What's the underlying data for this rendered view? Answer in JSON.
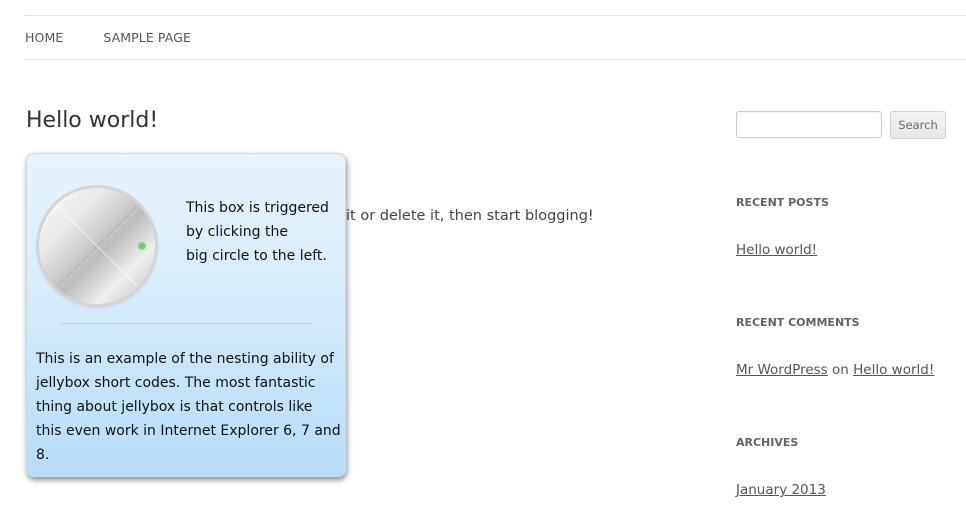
{
  "nav": {
    "items": [
      {
        "label": "HOME"
      },
      {
        "label": "SAMPLE PAGE"
      }
    ]
  },
  "post": {
    "title": "Hello world!",
    "content_visible": "it or delete it, then start blogging!"
  },
  "jellybox": {
    "trigger_lines": [
      "This box is triggered",
      "by clicking the",
      "big circle to the left."
    ],
    "body_text": "This is an example of the nesting ability of jellybox short codes. The most fantastic thing about jellybox is that controls like this even work in Internet Explorer 6, 7 and 8.",
    "indicator_color": "#5ed35e"
  },
  "sidebar": {
    "search": {
      "value": "",
      "button_label": "Search"
    },
    "recent_posts": {
      "title": "RECENT POSTS",
      "items": [
        "Hello world!"
      ]
    },
    "recent_comments": {
      "title": "RECENT COMMENTS",
      "items": [
        {
          "author": "Mr WordPress",
          "connector": "on",
          "post": "Hello world!"
        }
      ]
    },
    "archives": {
      "title": "ARCHIVES",
      "items": [
        "January 2013"
      ]
    }
  }
}
